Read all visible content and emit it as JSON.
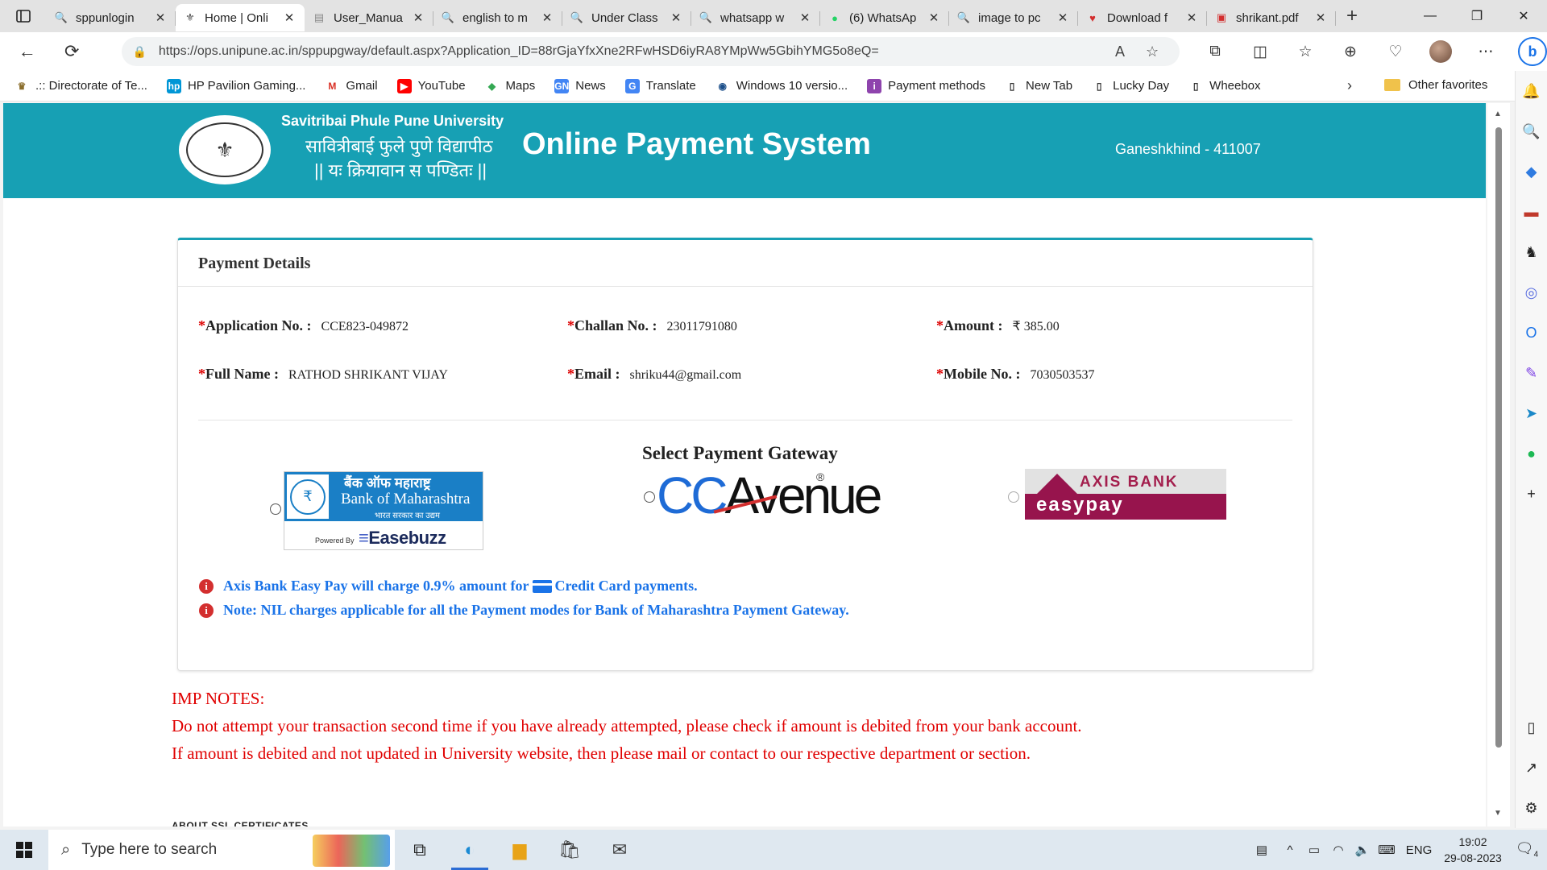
{
  "browser": {
    "tabs": [
      {
        "title": "sppunlogin",
        "icon": "search-icon",
        "active": false
      },
      {
        "title": "Home | Onli",
        "icon": "university-seal-icon",
        "active": true
      },
      {
        "title": "User_Manua",
        "icon": "document-icon",
        "active": false
      },
      {
        "title": "english to m",
        "icon": "search-icon",
        "active": false
      },
      {
        "title": "Under Class",
        "icon": "search-icon",
        "active": false
      },
      {
        "title": "whatsapp w",
        "icon": "search-icon",
        "active": false
      },
      {
        "title": "(6) WhatsAp",
        "icon": "whatsapp-icon",
        "active": false
      },
      {
        "title": "image to pc",
        "icon": "search-icon",
        "active": false
      },
      {
        "title": "Download f",
        "icon": "heart-icon",
        "active": false
      },
      {
        "title": "shrikant.pdf",
        "icon": "pdf-icon",
        "active": false
      }
    ],
    "url": "https://ops.unipune.ac.in/sppupgway/default.aspx?Application_ID=88rGjaYfxXne2RFwHSD6iyRA8YMpWw5GbihYMG5o8eQ=",
    "favorites": [
      {
        "label": ".:: Directorate of Te...",
        "icon": "emblem-icon"
      },
      {
        "label": "HP Pavilion Gaming...",
        "icon": "hp-icon"
      },
      {
        "label": "Gmail",
        "icon": "gmail-icon"
      },
      {
        "label": "YouTube",
        "icon": "youtube-icon"
      },
      {
        "label": "Maps",
        "icon": "maps-icon"
      },
      {
        "label": "News",
        "icon": "news-icon"
      },
      {
        "label": "Translate",
        "icon": "translate-icon"
      },
      {
        "label": "Windows 10 versio...",
        "icon": "windows-icon"
      },
      {
        "label": "Payment methods",
        "icon": "payment-icon"
      },
      {
        "label": "New Tab",
        "icon": "page-icon"
      },
      {
        "label": "Lucky Day",
        "icon": "page-icon"
      },
      {
        "label": "Wheebox",
        "icon": "page-icon"
      }
    ],
    "other_favorites": "Other favorites"
  },
  "header": {
    "university_en": "Savitribai Phule Pune University",
    "university_mr": "सावित्रीबाई फुले पुणे विद्यापीठ",
    "motto": "|| यः क्रियावान स पण्डितः ||",
    "title": "Online Payment System",
    "location": "Ganeshkhind - 411007",
    "color": "#17a0b4"
  },
  "payment": {
    "heading": "Payment Details",
    "fields": {
      "application_no": {
        "label": "Application No. :",
        "value": "CCE823-049872"
      },
      "challan_no": {
        "label": "Challan No. :",
        "value": "23011791080"
      },
      "amount": {
        "label": "Amount :",
        "value": "₹ 385.00"
      },
      "full_name": {
        "label": "Full Name :",
        "value": "RATHOD SHRIKANT VIJAY"
      },
      "email": {
        "label": "Email :",
        "value": "shriku44@gmail.com"
      },
      "mobile_no": {
        "label": "Mobile No. :",
        "value": "7030503537"
      }
    },
    "required_mark": "*"
  },
  "gateway": {
    "title": "Select Payment Gateway",
    "bom": {
      "hindi": "बैंक ऑफ महाराष्ट्र",
      "name": "Bank of Maharashtra",
      "tagline": "भारत सरकार का उद्यम",
      "powered": "Powered By",
      "easebuzz": "Easebuzz"
    },
    "ccavenue": {
      "cc": "CC",
      "avenue": "Avenue",
      "reg": "®"
    },
    "axis": {
      "name": "AXIS BANK",
      "easypay": "easypay"
    }
  },
  "notes": {
    "axis_charge_a": "Axis Bank Easy Pay will charge 0.9% amount for",
    "axis_charge_b": "Credit Card payments.",
    "nil_charge": "Note: NIL charges applicable for all the Payment modes for Bank of Maharashtra Payment Gateway."
  },
  "imp": {
    "title": "IMP NOTES:",
    "line1": "Do not attempt your transaction second time if you have already attempted, please check if amount is debited from your bank account.",
    "line2": "If amount is debited and not updated in University website, then please mail or contact to our respective department or section.",
    "ssl": "ABOUT SSL CERTIFICATES"
  },
  "taskbar": {
    "search_placeholder": "Type here to search",
    "lang": "ENG",
    "time": "19:02",
    "date": "29-08-2023",
    "notifications": "4"
  }
}
